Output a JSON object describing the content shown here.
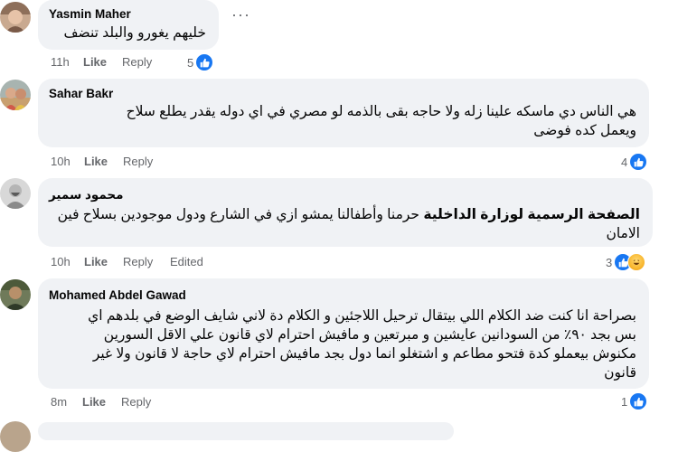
{
  "comments": [
    {
      "author": "Yasmin Maher",
      "text_lines": [
        "خليهم يغورو والبلد تنضف"
      ],
      "time": "11h",
      "like_label": "Like",
      "reply_label": "Reply",
      "reaction_count": "5",
      "reactions": [
        "like-icon"
      ]
    },
    {
      "author": "Sahar Bakr",
      "text_lines": [
        "هي الناس دي ماسكه علينا زله ولا حاجه بقى بالذمه لو مصري في اي دوله يقدر يطلع سلاح",
        "ويعمل كده فوضى"
      ],
      "time": "10h",
      "like_label": "Like",
      "reply_label": "Reply",
      "reaction_count": "4",
      "reactions": [
        "like-icon"
      ]
    },
    {
      "author": "محمود سمير",
      "tag_text": "الصفحة الرسمية لوزارة الداخلية",
      "text_rest": "حرمنا وأطفالنا يمشو ازي في الشارع ودول موجودين بسلاح فين",
      "text_line2": "الامان",
      "time": "10h",
      "like_label": "Like",
      "reply_label": "Reply",
      "edited_label": "Edited",
      "reaction_count": "3",
      "reactions": [
        "like-icon",
        "haha-icon"
      ]
    },
    {
      "author": "Mohamed Abdel Gawad",
      "text_lines": [
        "بصراحة انا كنت ضد الكلام اللي بيتقال ترحيل اللاجئين و الكلام دة لاني شايف الوضع في بلدهم اي",
        "بس بجد ٩٠٪ من السودانين عايشين و مبرتعين و مافيش احترام لاي قانون علي الاقل السورين",
        "مكنوش بيعملو كدة فتحو مطاعم و اشتغلو انما دول بجد مافيش احترام لاي حاجة لا قانون ولا غير",
        "قانون"
      ],
      "time": "8m",
      "like_label": "Like",
      "reply_label": "Reply",
      "reaction_count": "1",
      "reactions": [
        "like-icon"
      ]
    }
  ],
  "colors": {
    "bubble": "#f0f2f5",
    "meta": "#65676b",
    "like_blue": "#1877f2"
  }
}
